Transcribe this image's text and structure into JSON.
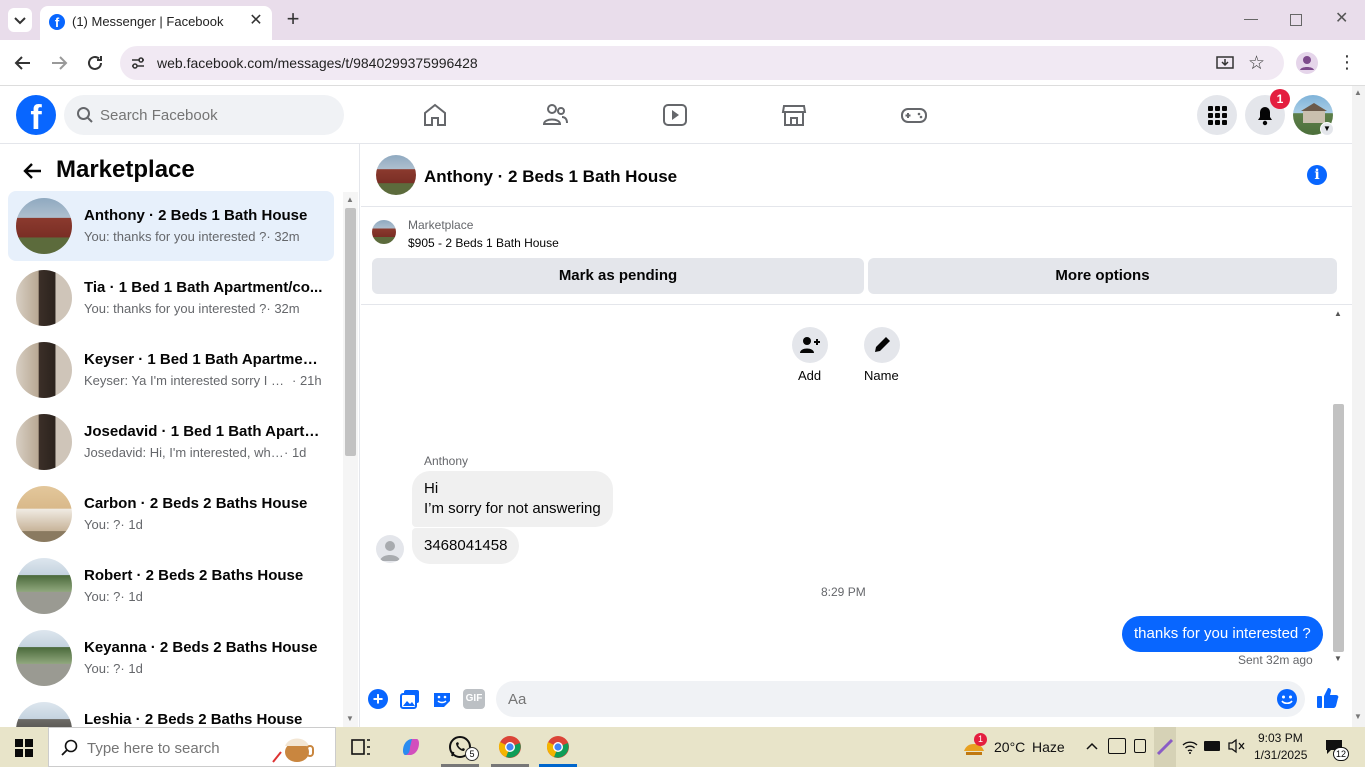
{
  "browser": {
    "tab_title": "(1) Messenger | Facebook",
    "url": "web.facebook.com/messages/t/9840299375996428"
  },
  "fb_header": {
    "search_placeholder": "Search Facebook",
    "notification_count": "1"
  },
  "sidebar": {
    "title": "Marketplace",
    "conversations": [
      {
        "title": "Anthony · 2 Beds 1 Bath House",
        "preview": "You: thanks for you interested ?",
        "time": "· 32m"
      },
      {
        "title": "Tia · 1 Bed 1 Bath Apartment/co...",
        "preview": "You: thanks for you interested ?",
        "time": "· 32m"
      },
      {
        "title": "Keyser · 1 Bed 1 Bath Apartment...",
        "preview": "Keyser: Ya I'm interested sorry I d...",
        "time": "· 21h"
      },
      {
        "title": "Josedavid · 1 Bed 1 Bath Apartm...",
        "preview": "Josedavid: Hi, I'm interested, when ...",
        "time": "· 1d"
      },
      {
        "title": "Carbon · 2 Beds 2 Baths House",
        "preview": "You: ?",
        "time": "· 1d"
      },
      {
        "title": "Robert · 2 Beds 2 Baths House",
        "preview": "You: ?",
        "time": "· 1d"
      },
      {
        "title": "Keyanna · 2 Beds 2 Baths House",
        "preview": "You: ?",
        "time": "· 1d"
      },
      {
        "title": "Leshia · 2 Beds 2 Baths House",
        "preview": "",
        "time": ""
      }
    ]
  },
  "chat": {
    "title": "Anthony · 2 Beds 1 Bath House",
    "listing_label": "Marketplace",
    "listing_detail": "$905 - 2 Beds 1 Bath House",
    "mark_pending": "Mark as pending",
    "more_options": "More options",
    "add_label": "Add",
    "name_label": "Name",
    "sender_name": "Anthony",
    "msg1_line1": "Hi",
    "msg1_line2": "I’m sorry for not answering",
    "msg2": "3468041458",
    "timestamp": "8:29 PM",
    "my_msg": "thanks for you interested ?",
    "sent_status": "Sent 32m ago",
    "composer_placeholder": "Aa"
  },
  "taskbar": {
    "search_placeholder": "Type here to search",
    "whatsapp_badge": "5",
    "weather_temp": "20°C",
    "weather_desc": "Haze",
    "weather_badge": "1",
    "time": "9:03 PM",
    "date": "1/31/2025",
    "notif_count": "12"
  },
  "colors": {
    "fb_blue": "#0866ff",
    "badge_red": "#e41e3f"
  }
}
